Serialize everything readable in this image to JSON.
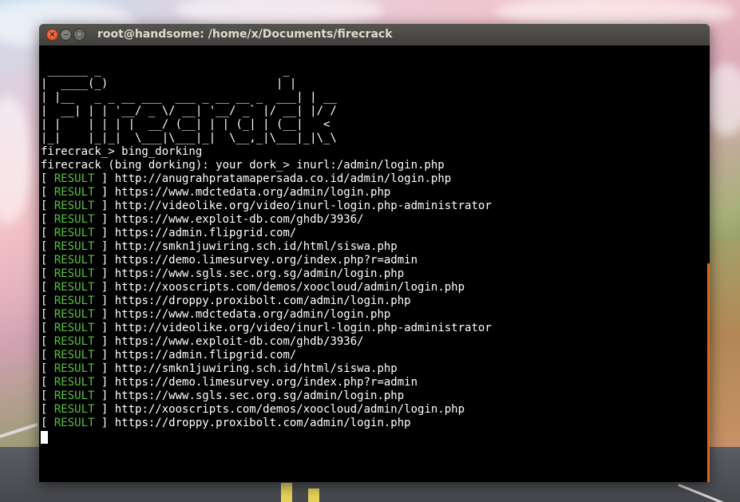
{
  "window": {
    "title": "root@handsome: /home/x/Documents/firecrack",
    "close_glyph": "×",
    "minimize_glyph": "–",
    "maximize_glyph": "□"
  },
  "terminal": {
    "banner": " ______ _                           _    \n|  ____(_)                         | |   \n| |__   _ _ __ ___  ___ _ __ __ _  ___| | __\n|  __| | | '__/ _ \\/ __| '__/ _` |/ __| |/ /\n| |    | | | |  __/ (__| | | (_| | (__|   < \n|_|    |_|_|  \\___|\\___|_|  \\__,_|\\___|_|\\_\\",
    "prompt_command": "firecrack_> bing_dorking",
    "dork_prompt": "firecrack (bing dorking): your dork_> inurl:/admin/login.php",
    "result_open": "[ ",
    "result_word": "RESULT",
    "result_close": " ] ",
    "results": [
      "http://anugrahpratamapersada.co.id/admin/login.php",
      "https://www.mdctedata.org/admin/login.php",
      "http://videolike.org/video/inurl-login.php-administrator",
      "https://www.exploit-db.com/ghdb/3936/",
      "https://admin.flipgrid.com/",
      "http://smkn1juwiring.sch.id/html/siswa.php",
      "https://demo.limesurvey.org/index.php?r=admin",
      "https://www.sgls.sec.org.sg/admin/login.php",
      "http://xooscripts.com/demos/xoocloud/admin/login.php",
      "https://droppy.proxibolt.com/admin/login.php",
      "https://www.mdctedata.org/admin/login.php",
      "http://videolike.org/video/inurl-login.php-administrator",
      "https://www.exploit-db.com/ghdb/3936/",
      "https://admin.flipgrid.com/",
      "http://smkn1juwiring.sch.id/html/siswa.php",
      "https://demo.limesurvey.org/index.php?r=admin",
      "https://www.sgls.sec.org.sg/admin/login.php",
      "http://xooscripts.com/demos/xoocloud/admin/login.php",
      "https://droppy.proxibolt.com/admin/login.php"
    ]
  },
  "colors": {
    "result_green": "#57c43a",
    "terminal_bg": "#000000",
    "scrollbar": "#e0651e"
  }
}
